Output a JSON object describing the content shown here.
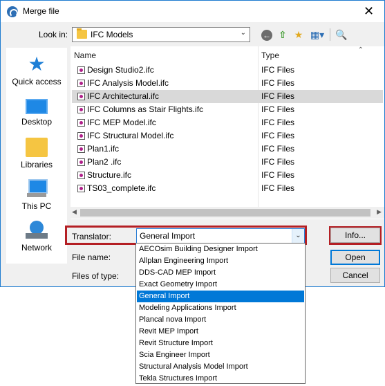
{
  "window": {
    "title": "Merge file",
    "close_glyph": "✕"
  },
  "lookin": {
    "label": "Look in:",
    "value": "IFC Models"
  },
  "places": [
    {
      "label": "Quick access",
      "icon": "star-icon"
    },
    {
      "label": "Desktop",
      "icon": "desktop-icon"
    },
    {
      "label": "Libraries",
      "icon": "libraries-icon"
    },
    {
      "label": "This PC",
      "icon": "computer-icon"
    },
    {
      "label": "Network",
      "icon": "network-icon"
    }
  ],
  "filelist": {
    "columns": {
      "name": "Name",
      "type": "Type"
    },
    "rows": [
      {
        "name": "Design Studio2.ifc",
        "type": "IFC Files"
      },
      {
        "name": "IFC Analysis Model.ifc",
        "type": "IFC Files"
      },
      {
        "name": "IFC Architectural.ifc",
        "type": "IFC Files"
      },
      {
        "name": "IFC Columns as Stair Flights.ifc",
        "type": "IFC Files"
      },
      {
        "name": "IFC MEP Model.ifc",
        "type": "IFC Files"
      },
      {
        "name": "IFC Structural Model.ifc",
        "type": "IFC Files"
      },
      {
        "name": "Plan1.ifc",
        "type": "IFC Files"
      },
      {
        "name": "Plan2 .ifc",
        "type": "IFC Files"
      },
      {
        "name": "Structure.ifc",
        "type": "IFC Files"
      },
      {
        "name": "TS03_complete.ifc",
        "type": "IFC Files"
      }
    ],
    "selected_index": 2
  },
  "translator": {
    "label": "Translator:",
    "value": "General Import",
    "options": [
      "AECOsim Building Designer Import",
      "Allplan Engineering Import",
      "DDS-CAD MEP Import",
      "Exact Geometry Import",
      "General Import",
      "Modeling Applications Import",
      "Plancal nova Import",
      "Revit MEP Import",
      "Revit Structure Import",
      "Scia Engineer Import",
      "Structural Analysis Model Import",
      "Tekla Structures Import"
    ],
    "highlighted_index": 4
  },
  "fields": {
    "filename_label": "File name:",
    "filetype_label": "Files of type:"
  },
  "buttons": {
    "info": "Info...",
    "open": "Open",
    "cancel": "Cancel"
  },
  "colors": {
    "highlight": "#b41f24",
    "selection": "#0078d7"
  }
}
